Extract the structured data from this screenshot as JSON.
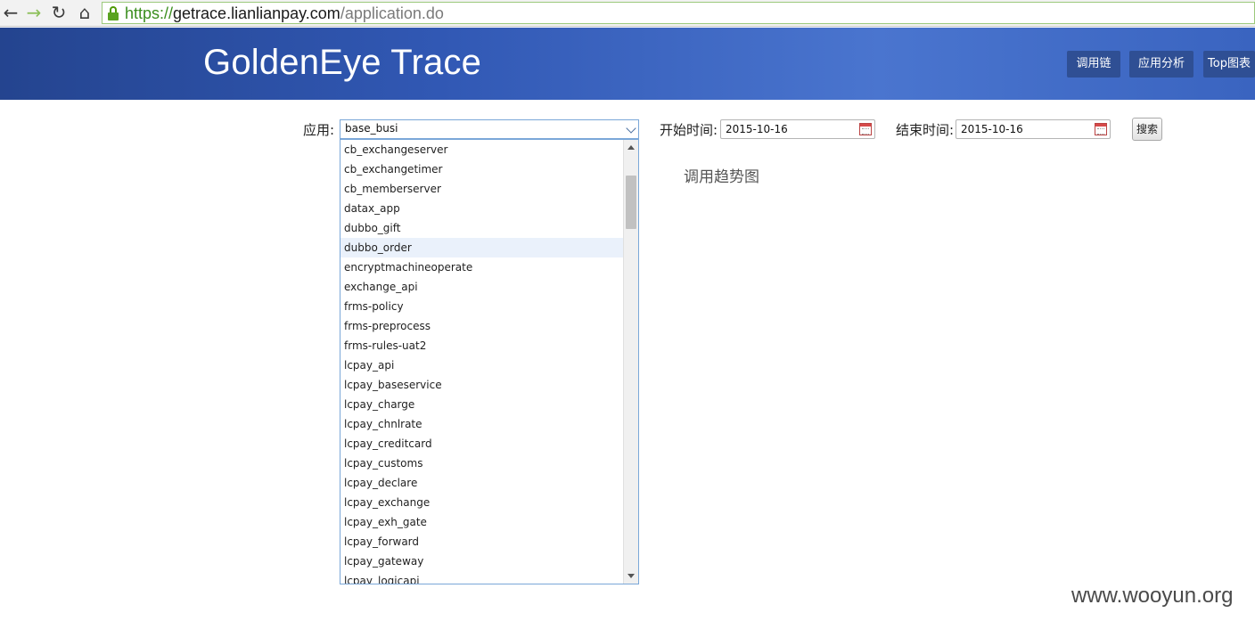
{
  "browser": {
    "url_scheme": "https://",
    "url_host": "getrace.lianlianpay.com",
    "url_path": "/application.do"
  },
  "header": {
    "brand": "GoldenEye Trace",
    "nav": [
      "调用链",
      "应用分析",
      "Top图表"
    ]
  },
  "filters": {
    "app_label": "应用:",
    "app_selected": "base_busi",
    "start_label": "开始时间:",
    "start_value": "2015-10-16",
    "end_label": "结束时间:",
    "end_value": "2015-10-16",
    "search_label": "搜索"
  },
  "chart_title": "调用趋势图",
  "dropdown": {
    "highlighted_index": 5,
    "options": [
      "cb_exchangeserver",
      "cb_exchangetimer",
      "cb_memberserver",
      "datax_app",
      "dubbo_gift",
      "dubbo_order",
      "encryptmachineoperate",
      "exchange_api",
      "frms-policy",
      "frms-preprocess",
      "frms-rules-uat2",
      "lcpay_api",
      "lcpay_baseservice",
      "lcpay_charge",
      "lcpay_chnlrate",
      "lcpay_creditcard",
      "lcpay_customs",
      "lcpay_declare",
      "lcpay_exchange",
      "lcpay_exh_gate",
      "lcpay_forward",
      "lcpay_gateway",
      "lcpay_logicapi"
    ]
  },
  "watermark": "www.wooyun.org"
}
